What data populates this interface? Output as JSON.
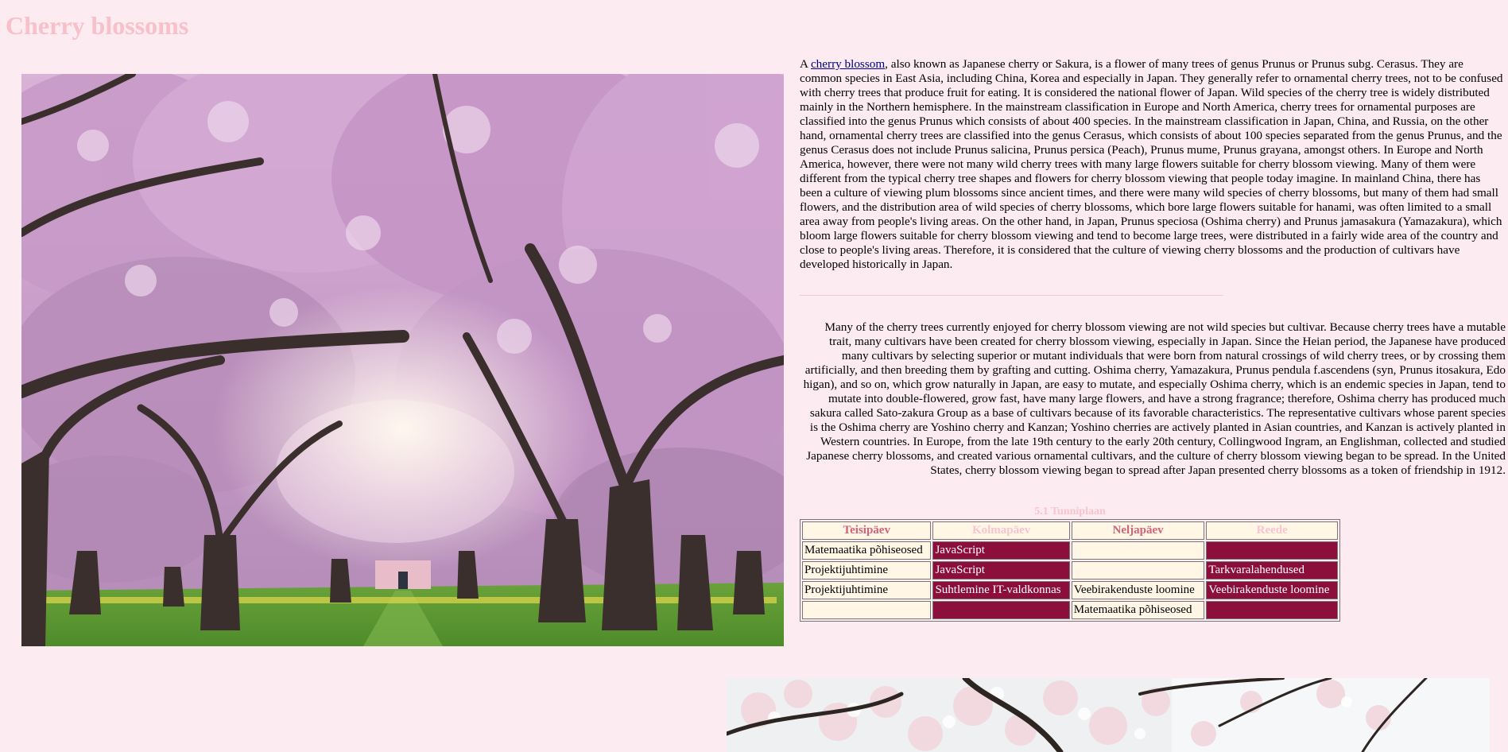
{
  "page": {
    "title": "Cherry blossoms"
  },
  "intro": {
    "prefix": "A ",
    "link_text": "cherry blossom",
    "text": ", also known as Japanese cherry or Sakura, is a flower of many trees of genus Prunus or Prunus subg. Cerasus. They are common species in East Asia, including China, Korea and especially in Japan. They generally refer to ornamental cherry trees, not to be confused with cherry trees that produce fruit for eating. It is considered the national flower of Japan. Wild species of the cherry tree is widely distributed mainly in the Northern hemisphere. In the mainstream classification in Europe and North America, cherry trees for ornamental purposes are classified into the genus Prunus which consists of about 400 species. In the mainstream classification in Japan, China, and Russia, on the other hand, ornamental cherry trees are classified into the genus Cerasus, which consists of about 100 species separated from the genus Prunus, and the genus Cerasus does not include Prunus salicina, Prunus persica (Peach), Prunus mume, Prunus grayana, amongst others. In Europe and North America, however, there were not many wild cherry trees with many large flowers suitable for cherry blossom viewing. Many of them were different from the typical cherry tree shapes and flowers for cherry blossom viewing that people today imagine. In mainland China, there has been a culture of viewing plum blossoms since ancient times, and there were many wild species of cherry blossoms, but many of them had small flowers, and the distribution area of wild species of cherry blossoms, which bore large flowers suitable for hanami, was often limited to a small area away from people's living areas. On the other hand, in Japan, Prunus speciosa (Oshima cherry) and Prunus jamasakura (Yamazakura), which bloom large flowers suitable for cherry blossom viewing and tend to become large trees, were distributed in a fairly wide area of the country and close to people's living areas. Therefore, it is considered that the culture of viewing cherry blossoms and the production of cultivars have developed historically in Japan."
  },
  "cultivars": {
    "text": "Many of the cherry trees currently enjoyed for cherry blossom viewing are not wild species but cultivar. Because cherry trees have a mutable trait, many cultivars have been created for cherry blossom viewing, especially in Japan. Since the Heian period, the Japanese have produced many cultivars by selecting superior or mutant individuals that were born from natural crossings of wild cherry trees, or by crossing them artificially, and then breeding them by grafting and cutting. Oshima cherry, Yamazakura, Prunus pendula f.ascendens (syn, Prunus itosakura, Edo higan), and so on, which grow naturally in Japan, are easy to mutate, and especially Oshima cherry, which is an endemic species in Japan, tend to mutate into double-flowered, grow fast, have many large flowers, and have a strong fragrance; therefore, Oshima cherry has produced much sakura called Sato-zakura Group as a base of cultivars because of its favorable characteristics. The representative cultivars whose parent species is the Oshima cherry are Yoshino cherry and Kanzan; Yoshino cherries are actively planted in Asian countries, and Kanzan is actively planted in Western countries. In Europe, from the late 19th century to the early 20th century, Collingwood Ingram, an Englishman, collected and studied Japanese cherry blossoms, and created various ornamental cultivars, and the culture of cherry blossom viewing began to be spread. In the United States, cherry blossom viewing began to spread after Japan presented cherry blossoms as a token of friendship in 1912."
  },
  "timetable": {
    "caption": "5.1 Tunniplaan",
    "headers": [
      "Teisipäev",
      "Kolmapäev",
      "Neljapäev",
      "Reede"
    ],
    "rows": [
      [
        "Matemaatika põhiseosed",
        "JavaScript",
        "",
        ""
      ],
      [
        "Projektijuhtimine",
        "JavaScript",
        "",
        "Tarkvaralahendused"
      ],
      [
        "Projektijuhtimine",
        "Suhtlemine IT-valdkonnas",
        "Veebirakenduste loomine",
        "Veebirakenduste loomine"
      ],
      [
        "",
        "",
        "Matemaatika põhiseosed",
        ""
      ]
    ]
  },
  "colors": {
    "background": "#fcebf0",
    "title": "#f8c0cb",
    "cell_cream": "#fff6e6",
    "cell_wine": "#8b0f3a",
    "link": "#00008b"
  }
}
